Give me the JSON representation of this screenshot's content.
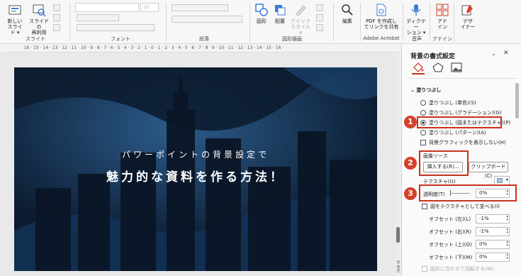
{
  "ribbon": {
    "slides_group": {
      "label": "スライド",
      "new_slide": [
        "新しい",
        "スライド ▾"
      ],
      "reuse_slide": [
        "スライドの",
        "再利用"
      ]
    },
    "font_group": {
      "label": "フォント",
      "font_size": "20"
    },
    "paragraph_group": {
      "label": "段落"
    },
    "drawing_group": {
      "label": "図形描画",
      "shapes": "図形",
      "arrange": "配置",
      "quick_styles": [
        "クイック",
        "スタイル ▾"
      ]
    },
    "editing": {
      "label": "編集"
    },
    "acrobat": {
      "label": "Adobe Acrobat",
      "button": [
        "PDF を作成し",
        "てリンクを共有"
      ]
    },
    "voice": {
      "label": "音声",
      "dictate": [
        "ディクテー",
        "ション ▾"
      ]
    },
    "addins": {
      "label": "アドイン",
      "button": [
        "アド",
        "イン"
      ]
    },
    "designer": {
      "button": [
        "デザ",
        "イナー"
      ]
    }
  },
  "ruler": {
    "text": "· 16 · 15 · 14 · 13 · 12 · 11 · 10 · 9 · 8 · 7 · 6 · 5 · 4 · 3 · 2 · 1 · 0 · 1 · 2 · 3 · 4 · 5 · 6 · 7 · 8 · 9 · 10 · 11 · 12 · 13 · 14 · 15 · 16 ·"
  },
  "slide": {
    "line1": "パワーポイントの背景設定で",
    "line2": "魅力的な資料を作る方法！"
  },
  "scroll_labels": {
    "top": "全体",
    "bottom": "全"
  },
  "pane": {
    "title": "背景の書式設定",
    "section": "塗りつぶし",
    "options": [
      {
        "label": "塗りつぶし (単色)(S)",
        "selected": false
      },
      {
        "label": "塗りつぶし (グラデーション)(G)",
        "selected": false
      },
      {
        "label": "塗りつぶし (図またはテクスチャ)(P)",
        "selected": true
      },
      {
        "label": "塗りつぶし (パターン)(A)",
        "selected": false
      }
    ],
    "hide_graphics": "背景グラフィックを表示しない(H)",
    "picture_source": "画像ソース",
    "insert_button": "挿入する(R)...",
    "clipboard_button": "クリップボード(C)",
    "texture_label": "テクスチャ(U)",
    "transparency_label": "透明度(T)",
    "transparency_value": "0%",
    "tile_label": "図をテクスチャとして並べる(I)",
    "offsets": [
      {
        "label": "オフセット (左)(L)",
        "value": "-1%"
      },
      {
        "label": "オフセット (右)(R)",
        "value": "-1%"
      },
      {
        "label": "オフセット (上)(O)",
        "value": "0%"
      },
      {
        "label": "オフセット (下)(M)",
        "value": "0%"
      }
    ],
    "rotate_label": "図形に合わせて回転する(W)"
  },
  "badges": [
    "1",
    "2",
    "3"
  ],
  "colors": {
    "accent_red": "#c8321e",
    "badge_red": "#d6402a",
    "slide_bg": "#0e1f35"
  }
}
